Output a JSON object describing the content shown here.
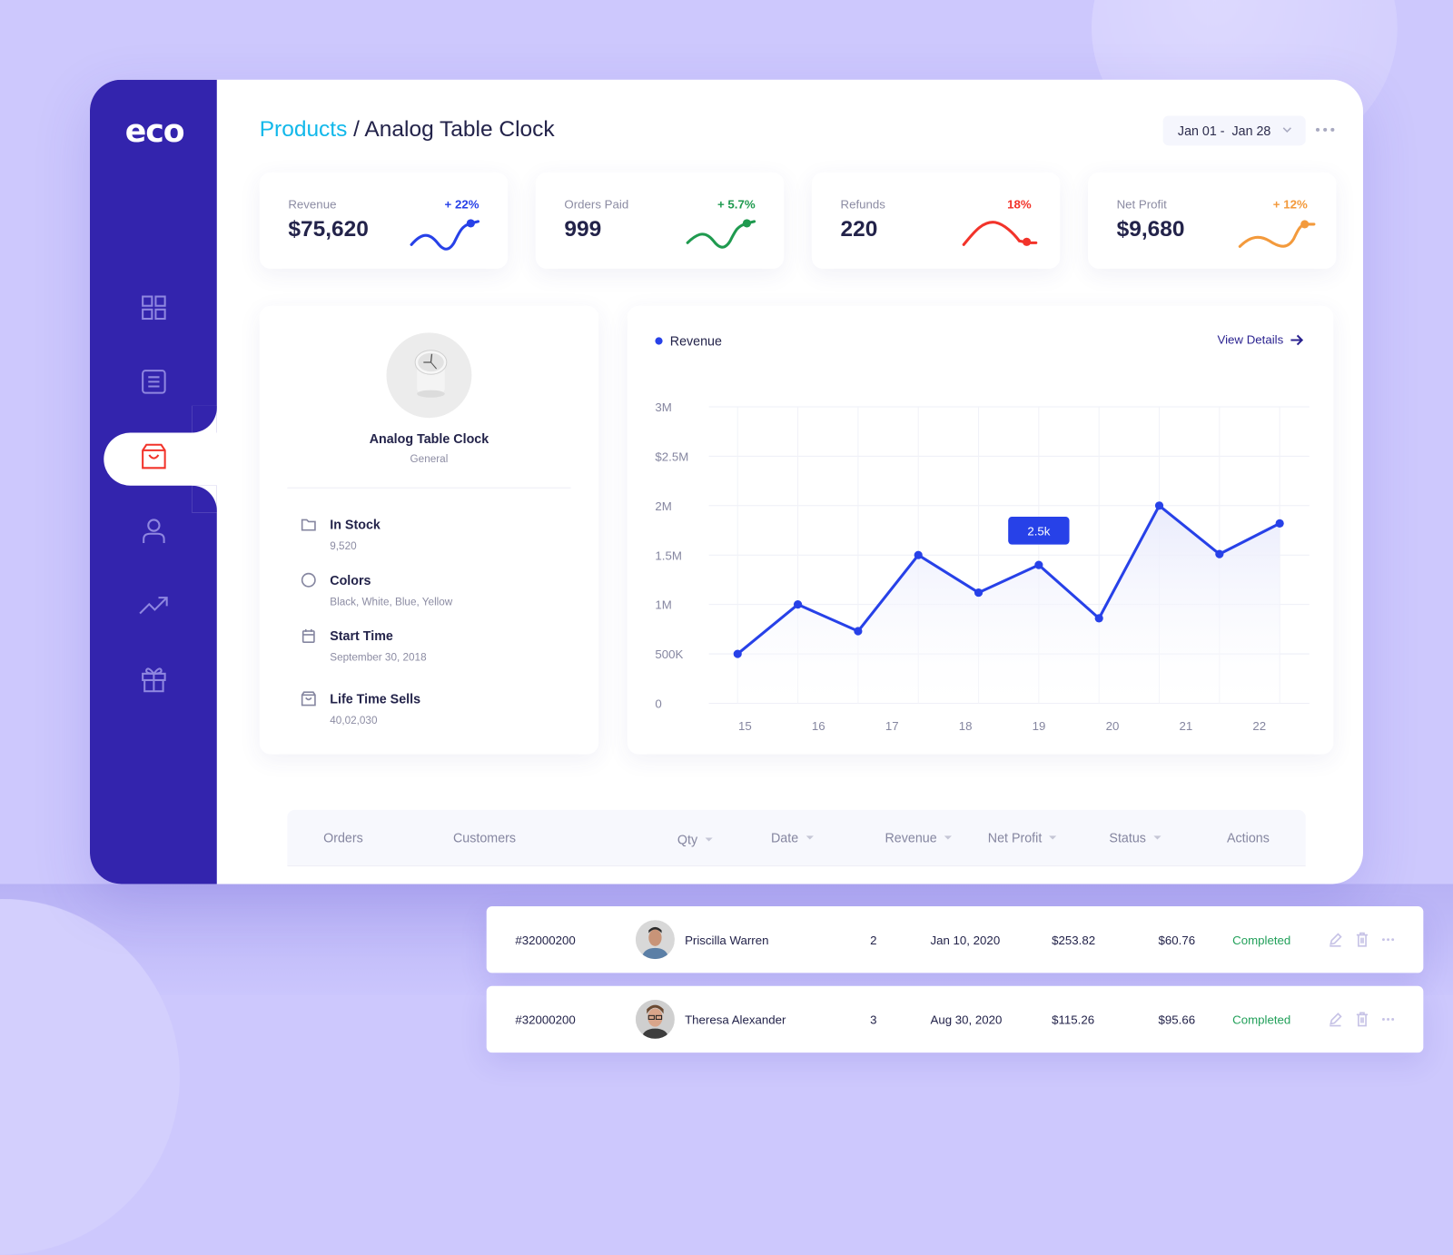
{
  "app": {
    "logo": "eco"
  },
  "sidebar": {
    "items": [
      {
        "name": "dashboard",
        "icon": "grid-icon",
        "active": false
      },
      {
        "name": "documents",
        "icon": "list-doc-icon",
        "active": false
      },
      {
        "name": "products",
        "icon": "shopping-bag-icon",
        "active": true
      },
      {
        "name": "customers",
        "icon": "user-icon",
        "active": false
      },
      {
        "name": "analytics",
        "icon": "trending-up-icon",
        "active": false
      },
      {
        "name": "rewards",
        "icon": "gift-icon",
        "active": false
      }
    ]
  },
  "header": {
    "breadcrumb_root": "Products",
    "separator": " / ",
    "title": "Analog Table Clock",
    "date_range": "Jan 01 -  Jan 28"
  },
  "stats": [
    {
      "label": "Revenue",
      "value": "$75,620",
      "delta": "+ 22%",
      "color": "#2741e8"
    },
    {
      "label": "Orders Paid",
      "value": "999",
      "delta": "+ 5.7%",
      "color": "#1f9a4f"
    },
    {
      "label": "Refunds",
      "value": "220",
      "delta": "18%",
      "color": "#f2332a"
    },
    {
      "label": "Net Profit",
      "value": "$9,680",
      "delta": "+ 12%",
      "color": "#f39a3c"
    }
  ],
  "product": {
    "name": "Analog Table Clock",
    "category": "General",
    "attributes": [
      {
        "icon": "folder-icon",
        "label": "In Stock",
        "value": "9,520"
      },
      {
        "icon": "circle-icon",
        "label": "Colors",
        "value": "Black, White, Blue, Yellow"
      },
      {
        "icon": "calendar-icon",
        "label": "Start Time",
        "value": "September 30, 2018"
      },
      {
        "icon": "bag-icon",
        "label": "Life Time Sells",
        "value": "40,02,030"
      }
    ]
  },
  "chart": {
    "legend": "Revenue",
    "view_details": "View Details",
    "tooltip": "2.5k"
  },
  "chart_data": {
    "type": "line",
    "title": "",
    "legend": [
      "Revenue"
    ],
    "xlabel": "",
    "ylabel": "",
    "x_tick_labels": [
      "15",
      "16",
      "17",
      "18",
      "19",
      "20",
      "21",
      "22"
    ],
    "y_tick_labels": [
      "0",
      "500K",
      "1M",
      "1.5M",
      "2M",
      "$2.5M",
      "3M"
    ],
    "ylim": [
      0,
      3000000
    ],
    "grid": true,
    "series": [
      {
        "name": "Revenue",
        "color": "#2741e8",
        "values": [
          500000,
          1000000,
          730000,
          1500000,
          1120000,
          1400000,
          860000,
          2000000,
          1510000,
          1820000
        ]
      }
    ],
    "annotations": [
      {
        "text": "2.5k",
        "at_index": 5
      }
    ]
  },
  "table": {
    "columns": [
      "Orders",
      "Customers",
      "Qty",
      "Date",
      "Revenue",
      "Net Profit",
      "Status",
      "Actions"
    ],
    "sortable": [
      false,
      false,
      true,
      true,
      true,
      true,
      true,
      false
    ],
    "rows": [
      {
        "order": "#32000200",
        "customer": "Priscilla Warren",
        "qty": "2",
        "date": "Jan 10, 2020",
        "revenue": "$253.82",
        "net_profit": "$60.76",
        "status": "Completed"
      },
      {
        "order": "#32000200",
        "customer": "Theresa Alexander",
        "qty": "3",
        "date": "Aug 30, 2020",
        "revenue": "$115.26",
        "net_profit": "$95.66",
        "status": "Completed"
      }
    ]
  }
}
